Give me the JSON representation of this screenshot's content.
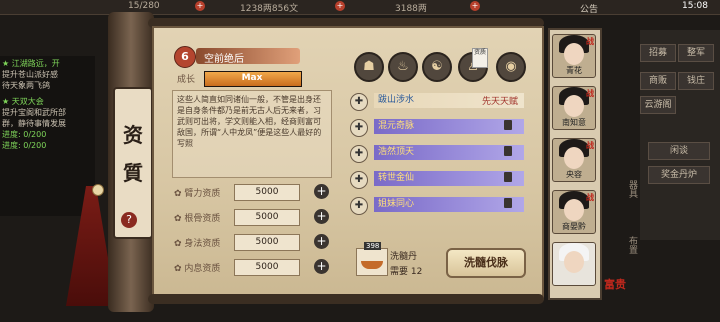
{
  "topbar": {
    "stamina": "15/280",
    "money": "1238两856文",
    "yuanbao": "3188两",
    "notice": "公告",
    "time": "15:08"
  },
  "left_log": [
    {
      "text": "★ 江湖路远，开",
      "color": "green"
    },
    {
      "text": "提升苍山派好感",
      "color": "white"
    },
    {
      "text": "待天象两飞鸽",
      "color": "white"
    },
    {
      "text": "★ 天双大会",
      "color": "green"
    },
    {
      "text": "提升宝阁和武所部",
      "color": "white"
    },
    {
      "text": "群，静待事情发展",
      "color": "white"
    },
    {
      "text": "进度: 0/200",
      "color": "green"
    },
    {
      "text": "进度: 0/200",
      "color": "green"
    }
  ],
  "scroll_tab": {
    "chars": [
      "资",
      "質"
    ],
    "badge": "?"
  },
  "character": {
    "badge": "6",
    "name": "空前绝后",
    "growth_label": "成长",
    "growth_value": "Max",
    "growth_fraction": 1.0,
    "description": "这些人简直如同诸仙一般，不管是出身还是自身条件都乃是前无古人后无来者，习武则可出将，学文则能入相，经商则富可敌国，所谓“人中龙凤”便是这些人最好的写照"
  },
  "stats": [
    {
      "label": "臂力资质",
      "value": "5000"
    },
    {
      "label": "根骨资质",
      "value": "5000"
    },
    {
      "label": "身法资质",
      "value": "5000"
    },
    {
      "label": "内息资质",
      "value": "5000"
    }
  ],
  "icons": [
    {
      "name": "pot-icon",
      "glyph": "☗"
    },
    {
      "name": "teapot-icon",
      "glyph": "♨"
    },
    {
      "name": "taiji-icon",
      "glyph": "☯"
    },
    {
      "name": "figure-icon",
      "glyph": "♙"
    },
    {
      "name": "jade-icon",
      "glyph": "◉"
    }
  ],
  "skill_tag": "资质",
  "skills": [
    {
      "name": "跋山涉水",
      "tail": "先天天赋",
      "locked": false
    },
    {
      "name": "混元奇脉",
      "tail": "",
      "locked": true
    },
    {
      "name": "浩然顶天",
      "tail": "",
      "locked": true
    },
    {
      "name": "转世金仙",
      "tail": "",
      "locked": true
    },
    {
      "name": "姐妹同心",
      "tail": "",
      "locked": true
    }
  ],
  "pill": {
    "count": "398",
    "name": "洗髓丹",
    "need_label": "需要",
    "need": "12"
  },
  "action_button": "洗髓伐脉",
  "portraits": [
    {
      "name": "青花"
    },
    {
      "name": "南知意"
    },
    {
      "name": "央容"
    },
    {
      "name": "商晏黔"
    },
    {
      "name": ""
    }
  ],
  "portrait_tag": "战",
  "right_menu": [
    "招募",
    "整军",
    "商贩",
    "钱庄",
    "云游阁",
    "闲谈",
    "奖金丹炉"
  ],
  "right_vertical": [
    "器",
    "具",
    "布",
    "置"
  ],
  "seal": "富贵"
}
